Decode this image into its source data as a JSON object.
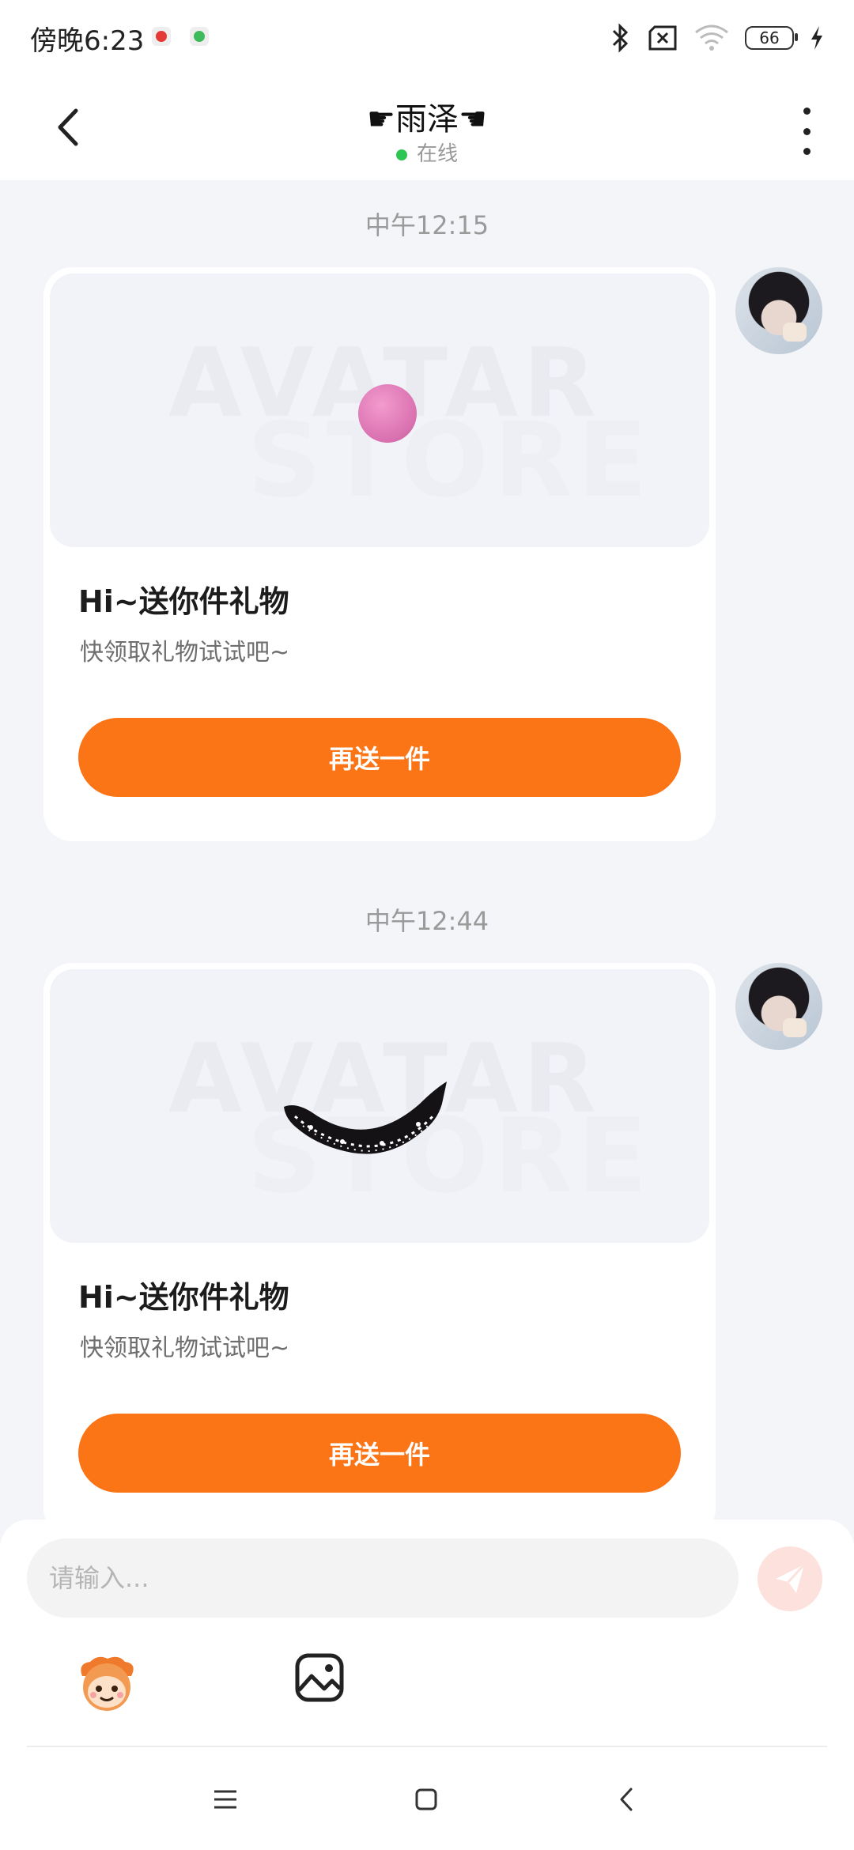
{
  "status_bar": {
    "time": "傍晚6:23",
    "battery": "66",
    "icons": [
      "bluetooth-icon",
      "no-sim-icon",
      "wifi-icon",
      "battery-icon",
      "charging-icon"
    ]
  },
  "header": {
    "title": "☛雨泽☚",
    "status": "在线",
    "status_color": "#2dc653"
  },
  "messages": [
    {
      "timestamp": "中午12:15",
      "gift_title": "Hi~送你件礼物",
      "gift_subtitle": "快领取礼物试试吧~",
      "button_label": "再送一件",
      "gift_item": "pink-ball",
      "watermark": [
        "AVATAR",
        "STORE"
      ]
    },
    {
      "timestamp": "中午12:44",
      "gift_title": "Hi~送你件礼物",
      "gift_subtitle": "快领取礼物试试吧~",
      "button_label": "再送一件",
      "gift_item": "black-lace-mask",
      "watermark": [
        "AVATAR",
        "STORE"
      ]
    }
  ],
  "input": {
    "placeholder": "请输入..."
  },
  "toolbar": {
    "icons": [
      "mascot-sticker-icon",
      "image-icon"
    ]
  },
  "navbar": {
    "icons": [
      "menu-icon",
      "home-icon",
      "back-icon"
    ]
  },
  "colors": {
    "accent": "#fb7415",
    "background": "#f3f5f8",
    "send_button_disabled": "#fde1dc"
  }
}
